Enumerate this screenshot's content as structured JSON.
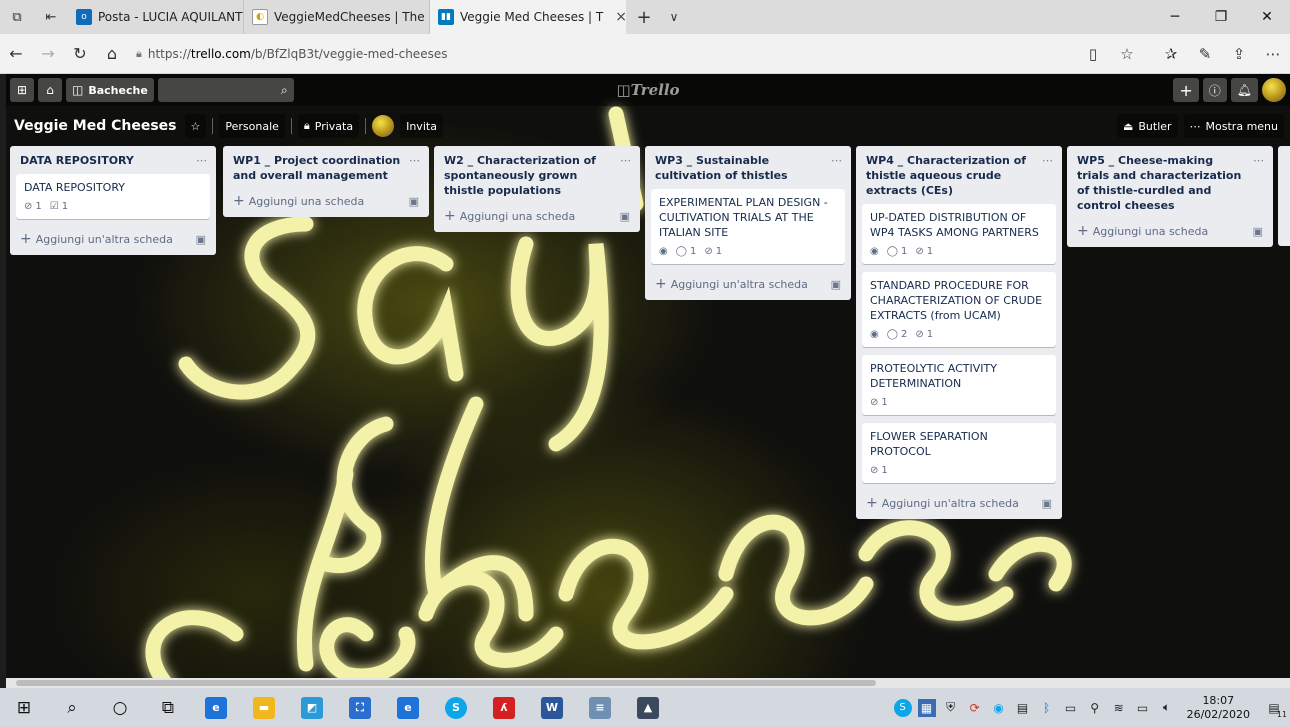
{
  "browser": {
    "tabs": [
      {
        "label": "Posta - LUCIA AQUILANTI -",
        "icon": "outlook-icon",
        "active": false
      },
      {
        "label": "VeggieMedCheeses | The N",
        "icon": "veggiemed-icon",
        "active": false
      },
      {
        "label": "Veggie Med Cheeses | T",
        "icon": "trello-icon",
        "active": true
      }
    ],
    "tab_close": "×",
    "new_tab": "+",
    "tab_menu": "∨",
    "url_prefix": "https://",
    "url_domain": "trello.com",
    "url_path": "/b/BfZlqB3t/veggie-med-cheeses"
  },
  "trello": {
    "boards_label": "Bacheche",
    "logo": "Trello",
    "board_name": "Veggie Med Cheeses",
    "team_label": "Personale",
    "visibility_label": "Privata",
    "invite_label": "Invita",
    "butler_label": "Butler",
    "menu_label": "Mostra menu",
    "add_card": "Aggiungi una scheda",
    "add_another_card": "Aggiungi un'altra scheda",
    "lists": [
      {
        "title": "DATA REPOSITORY",
        "cards": [
          {
            "title": "DATA REPOSITORY",
            "attachments": "1",
            "checklist": "1"
          }
        ]
      },
      {
        "title": "WP1 _ Project coordination and overall management",
        "cards": []
      },
      {
        "title": "W2 _ Characterization of spontaneously grown thistle populations",
        "cards": []
      },
      {
        "title": "WP3 _ Sustainable cultivation of thistles",
        "cards": [
          {
            "title": "EXPERIMENTAL PLAN DESIGN - CULTIVATION TRIALS AT THE ITALIAN SITE",
            "comments": "1",
            "attachments": "1"
          }
        ]
      },
      {
        "title": "WP4 _ Characterization of thistle aqueous crude extracts (CEs)",
        "cards": [
          {
            "title": "UP-DATED DISTRIBUTION OF WP4 TASKS AMONG PARTNERS",
            "comments": "1",
            "attachments": "1"
          },
          {
            "title": "STANDARD PROCEDURE FOR CHARACTERIZATION OF CRUDE EXTRACTS (from UCAM)",
            "comments": "2",
            "attachments": "1"
          },
          {
            "title": "PROTEOLYTIC ACTIVITY DETERMINATION",
            "attachments": "1"
          },
          {
            "title": "FLOWER SEPARATION PROTOCOL",
            "attachments": "1"
          }
        ]
      },
      {
        "title": "WP5 _ Cheese-making trials and characterization of thistle-curdled and control cheeses",
        "cards": []
      }
    ],
    "background_text": "say cheese"
  },
  "taskbar": {
    "time": "18:07",
    "date": "26/02/2020",
    "notifications": "11"
  },
  "colors": {
    "list_bg": "#ebecf0",
    "neon": "#f4f1a8",
    "trello_blue": "#0079bf"
  }
}
